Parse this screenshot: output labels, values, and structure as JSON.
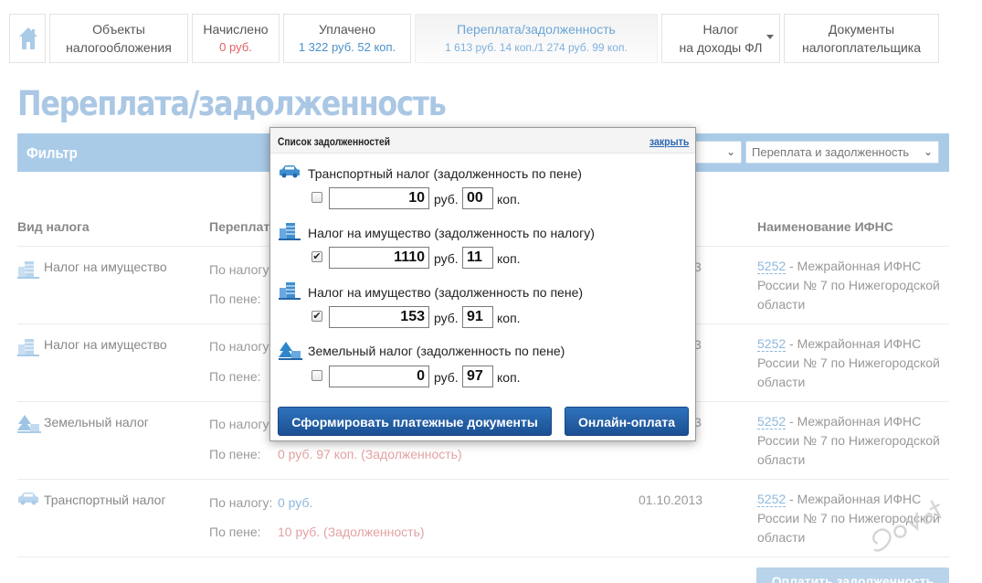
{
  "tabs": [
    {
      "name": "home",
      "icon": "home-icon"
    },
    {
      "line1": "Объекты",
      "line2": "налогообложения"
    },
    {
      "line1": "Начислено",
      "sub": "0 руб."
    },
    {
      "line1": "Уплачено",
      "sub": "1 322 руб. 52 коп."
    },
    {
      "line1": "Переплата/задолженность",
      "sub": "1 613 руб. 14 коп./1 274 руб. 99 коп."
    },
    {
      "line1": "Налог",
      "line2": "на доходы ФЛ"
    },
    {
      "line1": "Документы",
      "line2": "налогоплательщика"
    }
  ],
  "page": {
    "title": "Переплата/задолженность"
  },
  "filter": {
    "title": "Фильтр",
    "select2": "Переплата и задолженность"
  },
  "table": {
    "headers": {
      "tax_type": "Вид налога",
      "overpay": "Переплата",
      "ifns": "Наименование ИФНС"
    },
    "rows": [
      {
        "tax": "Налог на имущество",
        "label_tax": "По налогу:",
        "label_fine": "По пене:",
        "date": "3",
        "ifns_code": "5252",
        "ifns_text": " - Межрайонная ИФНС России № 7 по Нижегородской области"
      },
      {
        "tax": "Налог на имущество",
        "label_tax": "По налогу",
        "label_fine": "По пене:",
        "date": "3",
        "ifns_code": "5252",
        "ifns_text": " - Межрайонная ИФНС России № 7 по Нижегородской области"
      },
      {
        "tax": "Земельный налог",
        "label_tax": "По налогу",
        "label_fine": "По пене:",
        "fine_value": "0 руб. 97 коп. (Задолженность)",
        "date": "3",
        "ifns_code": "5252",
        "ifns_text": " - Межрайонная ИФНС России № 7 по Нижегородской области"
      },
      {
        "tax": "Транспортный налог",
        "label_tax": "По налогу:",
        "tax_value": "0 руб.",
        "label_fine": "По пене:",
        "fine_value": "10 руб. (Задолженность)",
        "date": "01.10.2013",
        "ifns_code": "5252",
        "ifns_text": " - Межрайонная ИФНС России № 7 по Нижегородской области"
      }
    ],
    "pay_all": "Оплатить задолженность"
  },
  "modal": {
    "title": "Список задолженностей",
    "close": "закрыть",
    "rub_label": "руб.",
    "kop_label": "коп.",
    "items": [
      {
        "title": "Транспортный налог (задолженность по пене)",
        "icon": "car-icon",
        "checked": false,
        "rub": "10",
        "kop": "00"
      },
      {
        "title": "Налог на имущество (задолженность по налогу)",
        "icon": "building-icon",
        "checked": true,
        "rub": "1110",
        "kop": "11"
      },
      {
        "title": "Налог на имущество (задолженность по пене)",
        "icon": "building-icon",
        "checked": true,
        "rub": "153",
        "kop": "91"
      },
      {
        "title": "Земельный налог (задолженность по пене)",
        "icon": "trees-icon",
        "checked": false,
        "rub": "0",
        "kop": "97"
      }
    ],
    "btn_generate": "Сформировать платежные документы",
    "btn_online": "Онлайн-оплата"
  },
  "watermark": "Sovet",
  "colors": {
    "accent": "#a9cbe8",
    "title": "#aac7e4",
    "button": "#2462a8",
    "debt": "#e3a2a2",
    "link": "#8fb8dc"
  }
}
